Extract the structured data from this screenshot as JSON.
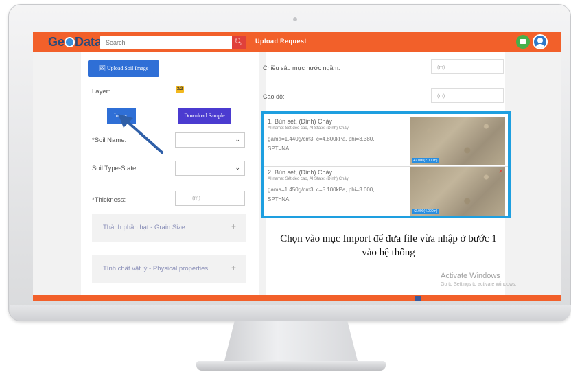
{
  "header": {
    "logo_prefix": "Ge",
    "logo_suffix": "Data",
    "search_placeholder": "Search",
    "nav": [
      "Upload",
      "Request"
    ]
  },
  "left": {
    "upload_button": "Upload Soil Image",
    "layer_label": "Layer:",
    "layer_badge": "3/2",
    "import_button": "Import",
    "download_button": "Download Sample",
    "soil_name_label": "*Soil Name:",
    "soil_type_label": "Soil Type-State:",
    "thickness_label": "*Thickness:",
    "thickness_placeholder": "(m)",
    "accordion_grain": "Thành phần hạt - Grain Size",
    "accordion_physical": "Tính chất vật lý - Physical properties"
  },
  "right": {
    "groundwater_label": "Chiều sâu mực nước ngầm:",
    "groundwater_placeholder": "(m)",
    "elevation_label": "Cao độ:",
    "elevation_placeholder": "(m)",
    "soils": [
      {
        "title": "1. Bùn sét, (Dính) Chảy",
        "ai": "AI name: Sét dẻo cao, AI State: (Dính) Chảy",
        "params_line1": "gama=1.440g/cm3, c=4.800kPa, phi=3.380,",
        "params_line2": "SPT=NA",
        "depth_tag": "+2.000(2.000m)"
      },
      {
        "title": "2. Bùn sét, (Dính) Chảy",
        "ai": "AI name: Sét dẻo cao, AI State: (Dính) Chảy",
        "params_line1": "gama=1.450g/cm3, c=5.100kPa, phi=3.600,",
        "params_line2": "SPT=NA",
        "depth_tag": "+2.000(4.000m)"
      }
    ]
  },
  "caption": {
    "line1": "Chọn vào mục Import để đưa file vừa nhập ở bước 1",
    "line2": "vào hệ thống"
  },
  "watermark": {
    "line1": "Activate Windows",
    "line2": "Go to Settings to activate Windows."
  },
  "colors": {
    "brand_orange": "#f2602a",
    "highlight_blue": "#1e9fe0",
    "button_blue": "#2f6fd6",
    "button_purple": "#4b3bd0"
  }
}
